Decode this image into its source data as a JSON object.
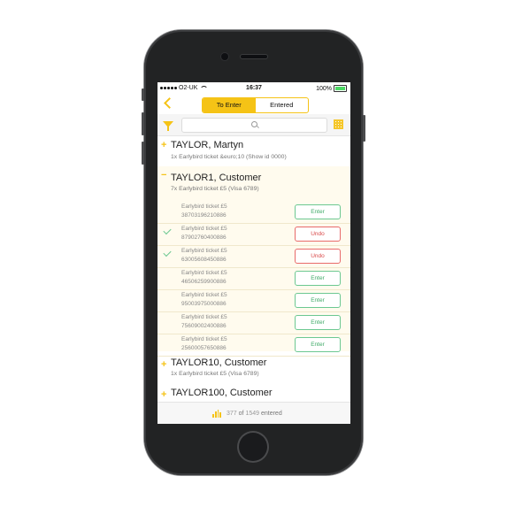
{
  "status": {
    "carrier": "O2-UK",
    "time": "16:37",
    "battery": "100%"
  },
  "nav": {
    "tabs": [
      {
        "label": "To Enter",
        "active": true
      },
      {
        "label": "Entered",
        "active": false
      }
    ]
  },
  "search": {
    "placeholder": ""
  },
  "customers": [
    {
      "toggle": "+",
      "name": "TAYLOR, Martyn",
      "sub": "1x Earlybird ticket &euro;10 (Show id 0000)"
    },
    {
      "toggle": "−",
      "name": "TAYLOR1, Customer",
      "sub": "7x Earlybird ticket £5 (Visa 6789)",
      "tickets": [
        {
          "label": "Earlybird ticket £5",
          "code": "38703196210886",
          "button": "Enter",
          "checked": false
        },
        {
          "label": "Earlybird ticket £5",
          "code": "87902760400886",
          "button": "Undo",
          "checked": true
        },
        {
          "label": "Earlybird ticket £5",
          "code": "63005608450886",
          "button": "Undo",
          "checked": true
        },
        {
          "label": "Earlybird ticket £5",
          "code": "46506259900886",
          "button": "Enter",
          "checked": false
        },
        {
          "label": "Earlybird ticket £5",
          "code": "95003975000886",
          "button": "Enter",
          "checked": false
        },
        {
          "label": "Earlybird ticket £5",
          "code": "75609002400886",
          "button": "Enter",
          "checked": false
        },
        {
          "label": "Earlybird ticket £5",
          "code": "25600057650886",
          "button": "Enter",
          "checked": false
        }
      ]
    },
    {
      "toggle": "+",
      "name": "TAYLOR10, Customer",
      "sub": "1x Earlybird ticket £5 (Visa 6789)"
    },
    {
      "toggle": "+",
      "name": "TAYLOR100, Customer",
      "sub": ""
    }
  ],
  "footer": {
    "count": "377",
    "of": "of",
    "total": "1549",
    "suffix": "entered"
  },
  "colors": {
    "accent": "#f5c316",
    "enter": "#6cc891",
    "undo": "#e86a6a"
  }
}
